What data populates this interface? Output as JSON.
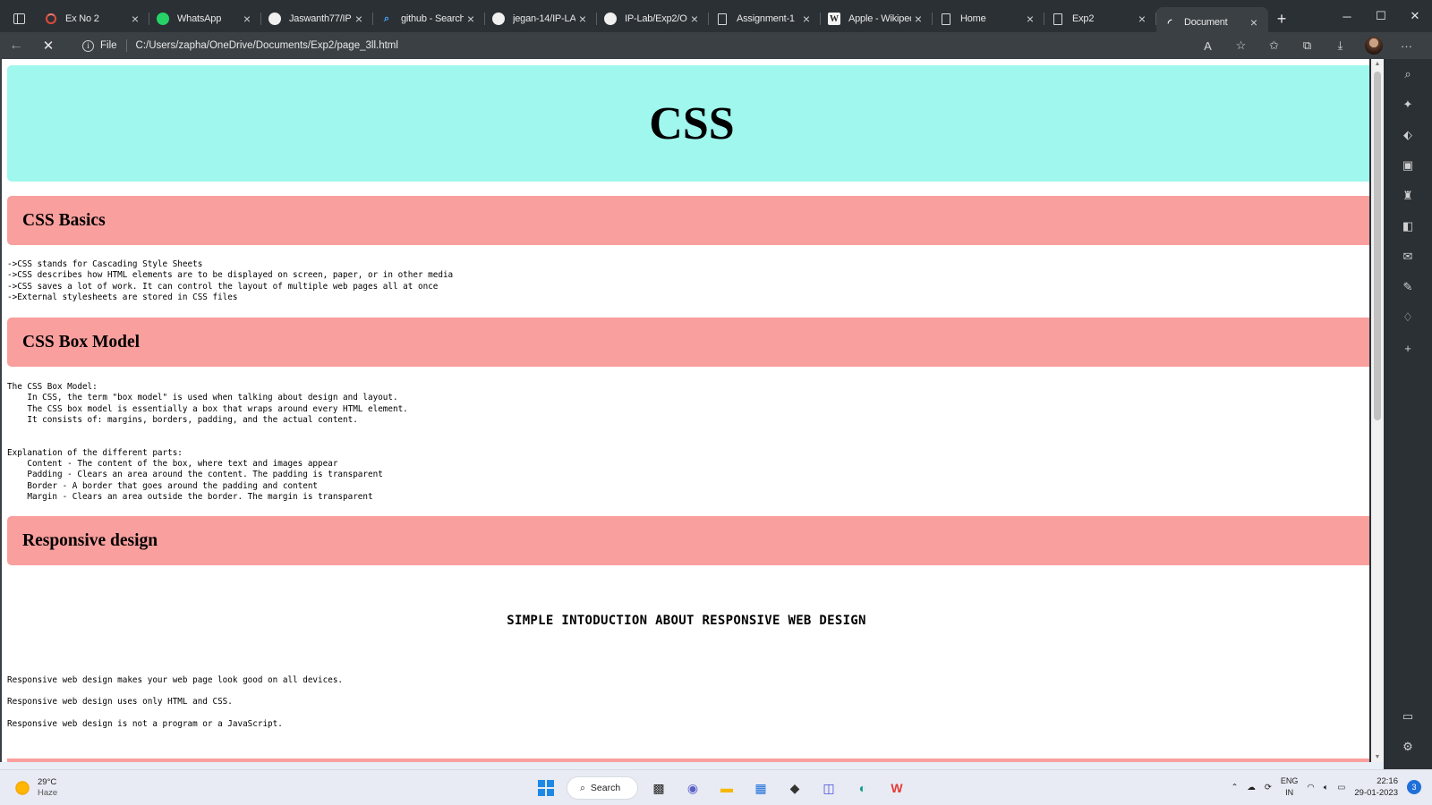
{
  "browser": {
    "tabs": [
      {
        "title": "Ex No 2",
        "icon": "spinner-icon",
        "active": false
      },
      {
        "title": "WhatsApp",
        "icon": "whatsapp-icon",
        "active": false
      },
      {
        "title": "Jaswanth77/IP-L",
        "icon": "github-icon",
        "active": false
      },
      {
        "title": "github - Search",
        "icon": "search-icon",
        "active": false
      },
      {
        "title": "jegan-14/IP-LAB",
        "icon": "github-icon",
        "active": false
      },
      {
        "title": "IP-Lab/Exp2/Ou",
        "icon": "github-icon",
        "active": false
      },
      {
        "title": "Assignment-1",
        "icon": "document-icon",
        "active": false
      },
      {
        "title": "Apple - Wikiped",
        "icon": "wikipedia-icon",
        "active": false
      },
      {
        "title": "Home",
        "icon": "document-icon",
        "active": false
      },
      {
        "title": "Exp2",
        "icon": "document-icon",
        "active": false
      },
      {
        "title": "Document",
        "icon": "loading-icon",
        "active": true
      }
    ],
    "new_tab": "+",
    "address": {
      "scheme_label": "File",
      "url": "C:/Users/zapha/OneDrive/Documents/Exp2/page_3ll.html"
    }
  },
  "page": {
    "hero_title": "CSS",
    "sections": [
      {
        "heading": "CSS Basics",
        "body": "->CSS stands for Cascading Style Sheets\n->CSS describes how HTML elements are to be displayed on screen, paper, or in other media\n->CSS saves a lot of work. It can control the layout of multiple web pages all at once\n->External stylesheets are stored in CSS files"
      },
      {
        "heading": "CSS Box Model",
        "body": "The CSS Box Model:\n    In CSS, the term \"box model\" is used when talking about design and layout.\n    The CSS box model is essentially a box that wraps around every HTML element.\n    It consists of: margins, borders, padding, and the actual content.\n\n\nExplanation of the different parts:\n    Content - The content of the box, where text and images appear\n    Padding - Clears an area around the content. The padding is transparent\n    Border - A border that goes around the padding and content\n    Margin - Clears an area outside the border. The margin is transparent"
      },
      {
        "heading": "Responsive design",
        "subtitle": "SIMPLE INTODUCTION ABOUT RESPONSIVE WEB DESIGN",
        "paragraphs": [
          "Responsive web design makes your web page look good on all devices.",
          "Responsive web design uses only HTML and CSS.",
          "Responsive web design is not a program or a JavaScript."
        ]
      }
    ]
  },
  "taskbar": {
    "weather_temp": "29°C",
    "weather_desc": "Haze",
    "search_label": "Search",
    "lang_top": "ENG",
    "lang_bottom": "IN",
    "time": "22:16",
    "date": "29-01-2023",
    "notification_count": "3"
  },
  "colors": {
    "hero_bg": "#a0f7ee",
    "section_bg": "#f99f9d",
    "browser_frame": "#2b3035"
  }
}
